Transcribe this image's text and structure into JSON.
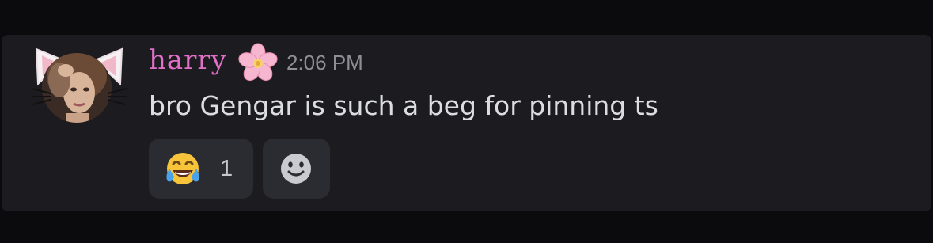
{
  "message": {
    "author": "harry",
    "author_color": "#e070c8",
    "author_badge": "cherry-blossom-icon",
    "timestamp": "2:06 PM",
    "content": "bro Gengar is such a beg for pinning ts",
    "reactions": [
      {
        "emoji": "face-with-tears-of-joy-icon",
        "count": "1"
      }
    ],
    "add_reaction_icon": "add-reaction-smiley-icon"
  },
  "colors": {
    "background": "#0b0b0d",
    "message_bg": "#1c1c20",
    "reaction_bg": "#2b2c31",
    "text": "#dcdde1",
    "muted": "#8e8e96"
  }
}
